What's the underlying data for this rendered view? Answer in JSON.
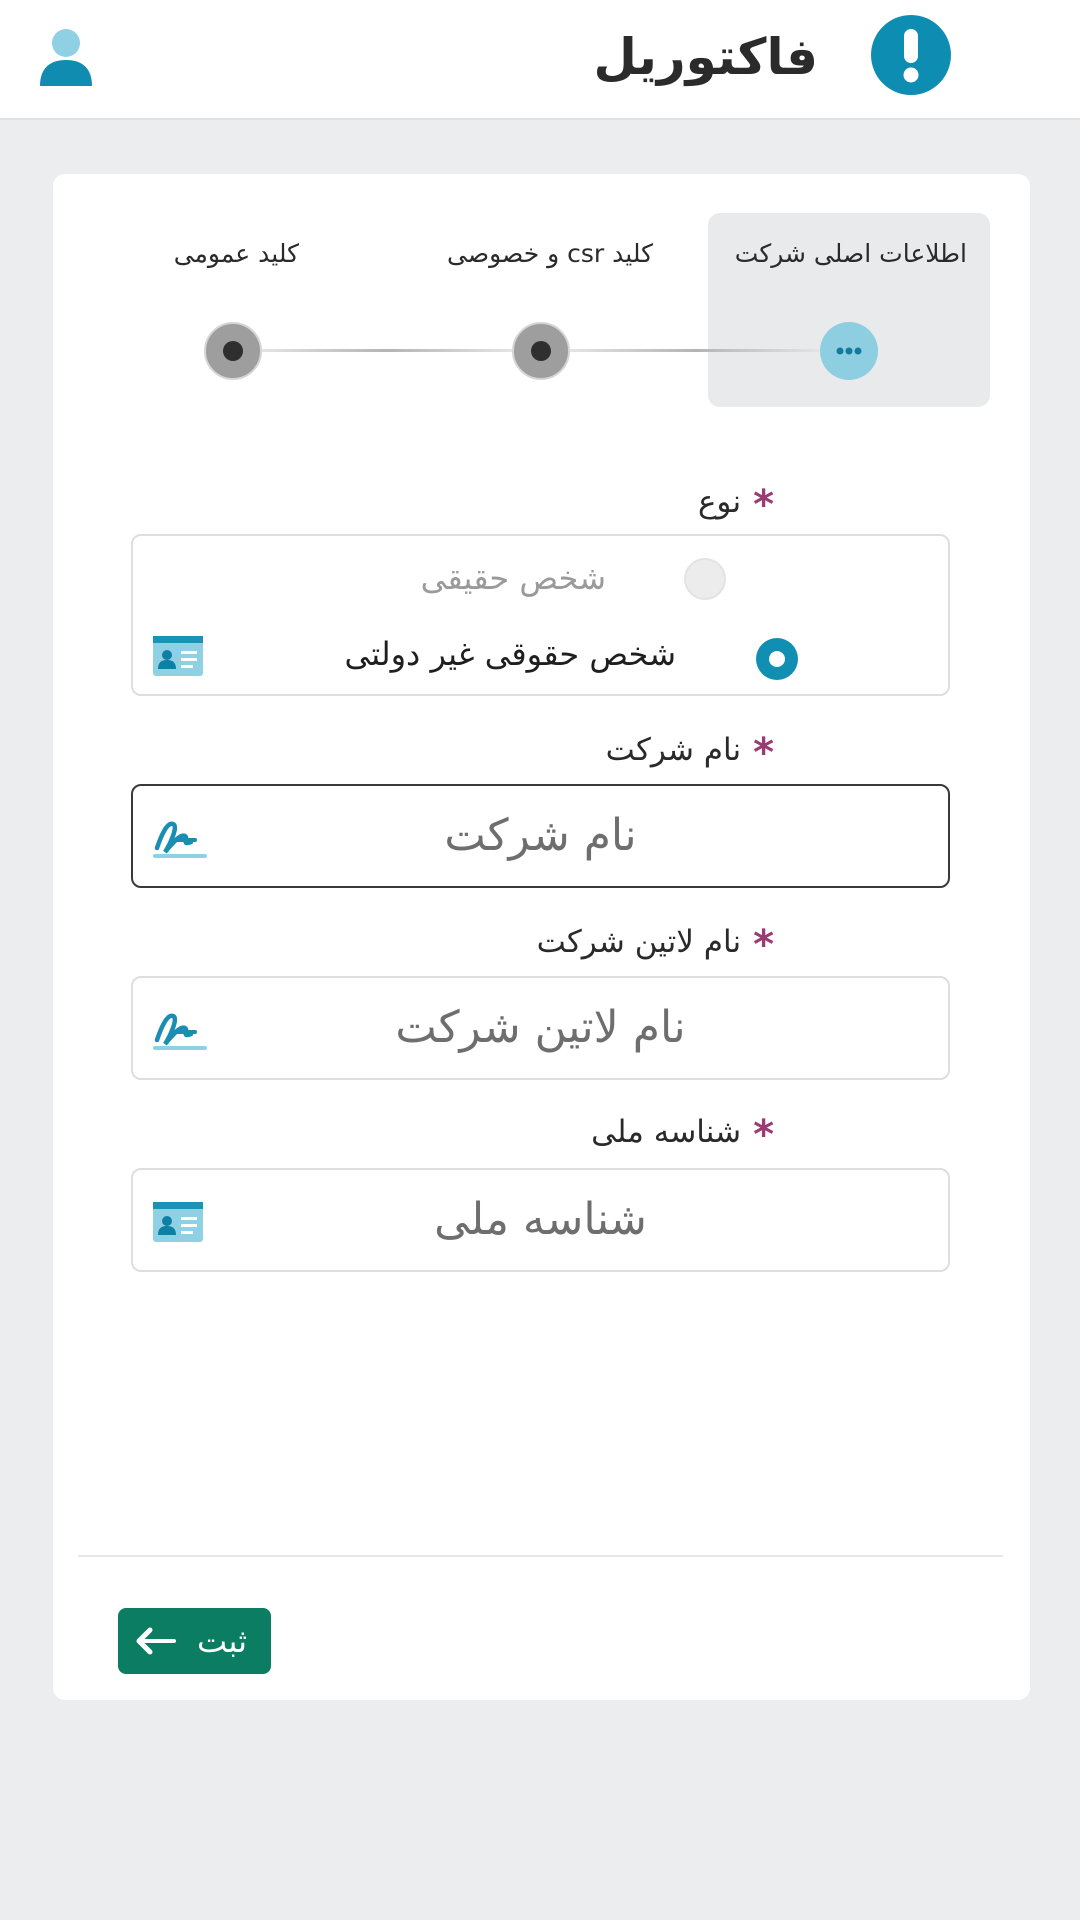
{
  "header": {
    "title": "فاکتوریل",
    "user_icon": "user-icon",
    "logo_icon": "exclamation-circle-icon"
  },
  "stepper": {
    "steps": [
      {
        "label": "اطلاعات اصلی شرکت",
        "state": "active"
      },
      {
        "label": "کلید csr و خصوصی",
        "state": "pending"
      },
      {
        "label": "کلید عمومی",
        "state": "pending"
      }
    ]
  },
  "form": {
    "type": {
      "label": "نوع",
      "required_mark": "*",
      "options": [
        {
          "label": "شخص حقیقی",
          "state": "disabled"
        },
        {
          "label": "شخص حقوقی غیر دولتی",
          "state": "checked"
        }
      ],
      "icon": "id-card-icon"
    },
    "company_name": {
      "label": "نام شرکت",
      "required_mark": "*",
      "placeholder": "نام شرکت",
      "value": "",
      "icon": "signature-icon"
    },
    "company_latin_name": {
      "label": "نام لاتین شرکت",
      "required_mark": "*",
      "placeholder": "نام لاتین شرکت",
      "value": "",
      "icon": "signature-icon"
    },
    "national_id": {
      "label": "شناسه ملی",
      "required_mark": "*",
      "placeholder": "شناسه ملی",
      "value": "",
      "icon": "id-card-icon"
    }
  },
  "footer": {
    "submit_label": "ثبت",
    "submit_icon": "arrow-left-icon"
  },
  "colors": {
    "accent": "#118fb3",
    "required": "#9a3b73",
    "submit": "#0b7d62",
    "background": "#ecedef"
  }
}
